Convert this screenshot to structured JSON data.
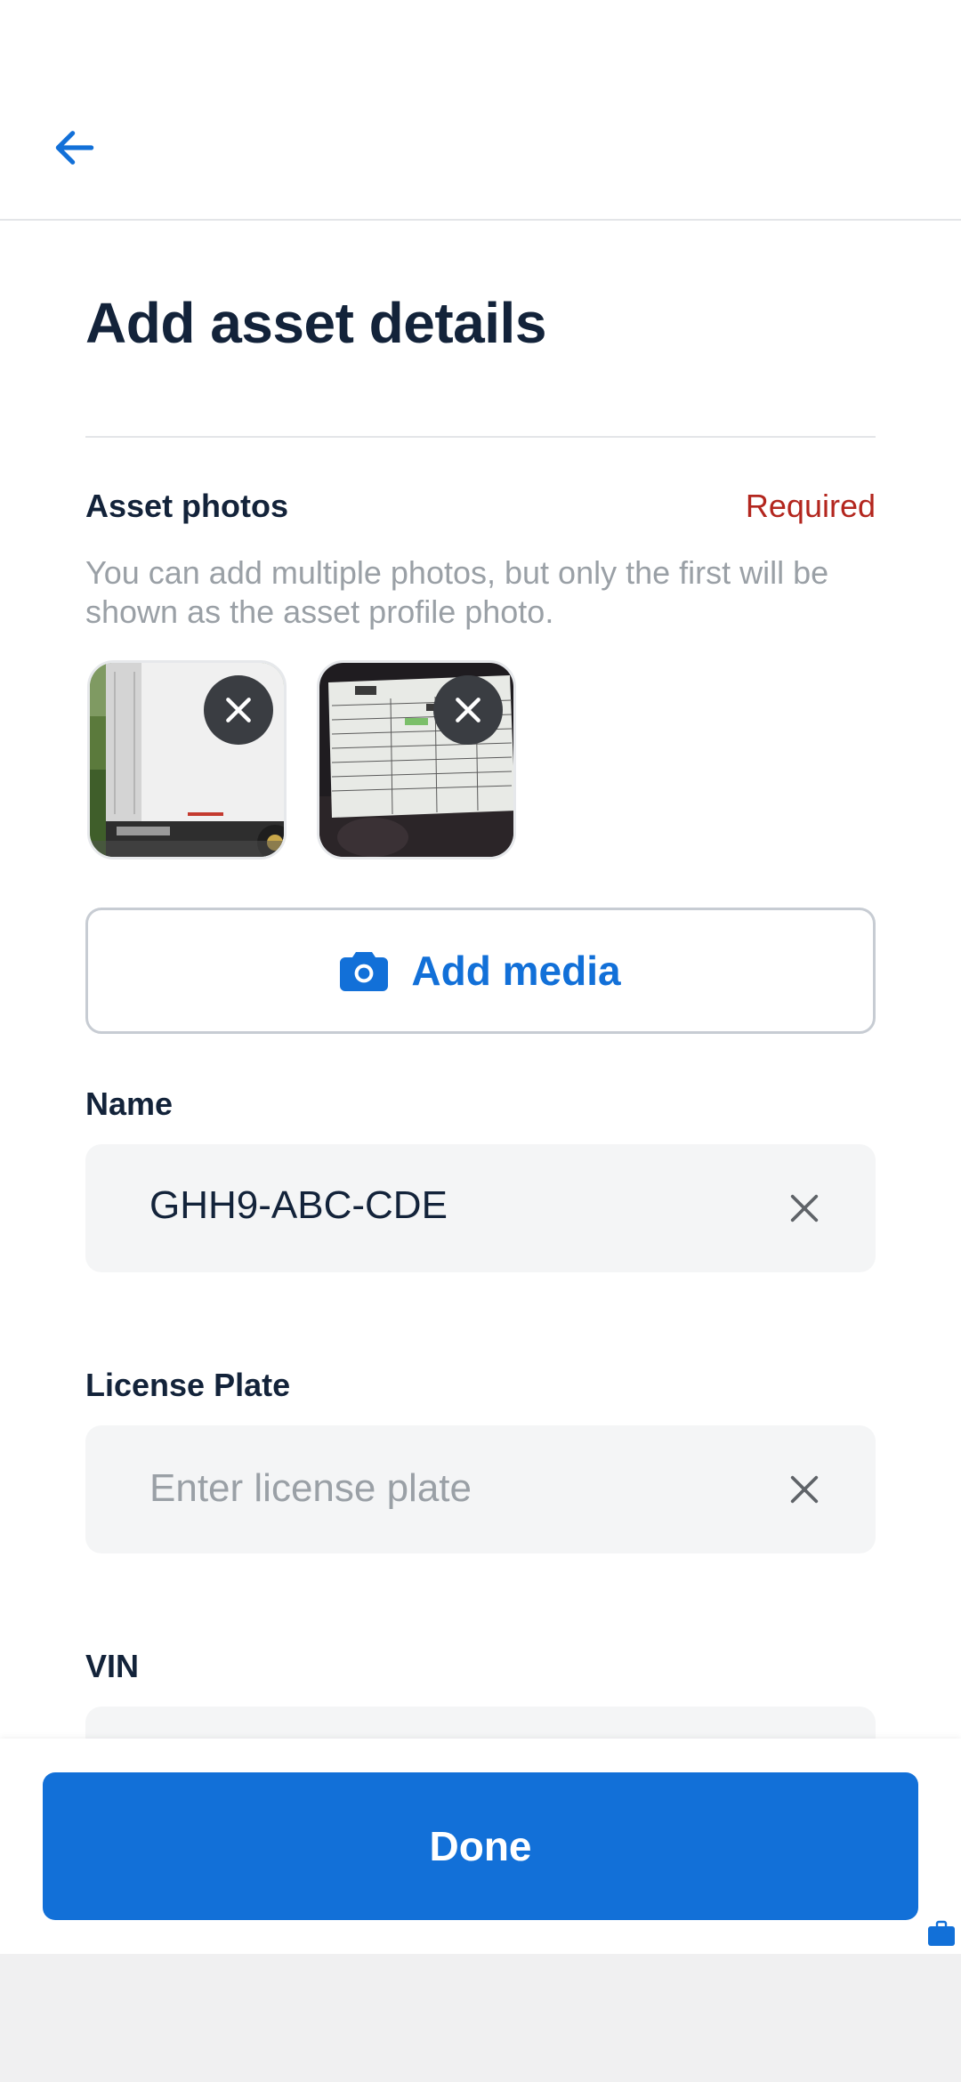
{
  "colors": {
    "primary": "#1270d8",
    "required": "#b3261e",
    "title": "#13233a",
    "helper": "#9aa0a6",
    "field_bg": "#f4f5f6"
  },
  "header": {
    "back_icon": "arrow-left-icon"
  },
  "page": {
    "title": "Add asset details"
  },
  "asset_photos": {
    "label": "Asset photos",
    "required_label": "Required",
    "helper": "You can add multiple photos, but only the first will be shown as the asset profile photo.",
    "photos": [
      {
        "name": "truck-photo",
        "remove_icon": "close-icon"
      },
      {
        "name": "document-photo",
        "remove_icon": "close-icon"
      }
    ],
    "add_media_label": "Add media",
    "add_media_icon": "camera-icon"
  },
  "fields": {
    "name": {
      "label": "Name",
      "value": "GHH9-ABC-CDE",
      "clear_icon": "close-icon"
    },
    "license_plate": {
      "label": "License Plate",
      "value": "",
      "placeholder": "Enter license plate",
      "clear_icon": "close-icon"
    },
    "vin": {
      "label": "VIN"
    }
  },
  "footer": {
    "done_label": "Done"
  }
}
